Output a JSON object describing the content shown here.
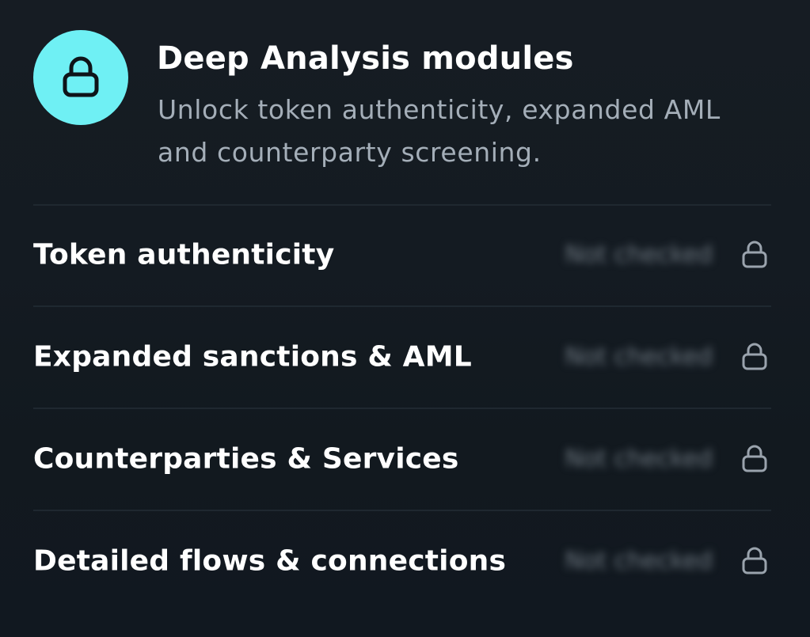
{
  "header": {
    "title": "Deep Analysis modules",
    "description": "Unlock token authenticity, expanded AML and counterparty screening.",
    "badge_icon": "lock-icon",
    "badge_color": "#6ff0f4"
  },
  "modules": [
    {
      "label": "Token authenticity",
      "status": "Not checked",
      "icon": "lock-icon"
    },
    {
      "label": "Expanded sanctions & AML",
      "status": "Not checked",
      "icon": "lock-icon"
    },
    {
      "label": "Counterparties & Services",
      "status": "Not checked",
      "icon": "lock-icon"
    },
    {
      "label": "Detailed flows & connections",
      "status": "Not checked",
      "icon": "lock-icon"
    }
  ],
  "colors": {
    "background": "#141b22",
    "title": "#ffffff",
    "description": "#a4aeb8",
    "divider": "#1f2830",
    "lock_icon": "#9aa3ad"
  }
}
